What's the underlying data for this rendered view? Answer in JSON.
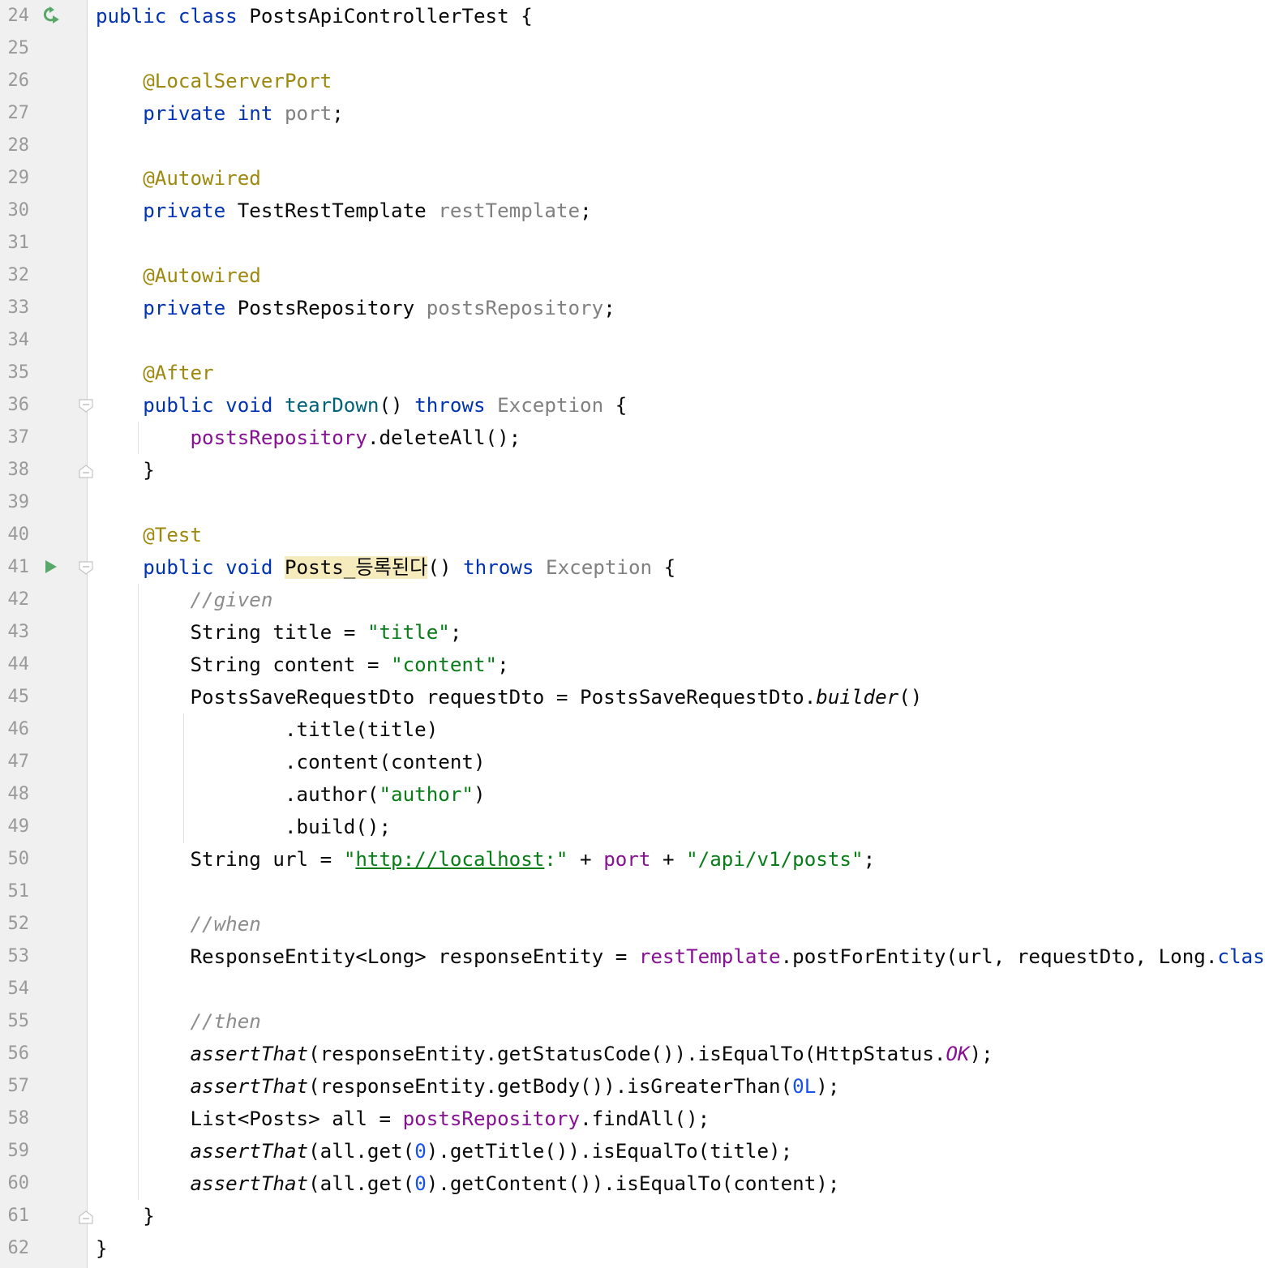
{
  "editor": {
    "file_class": "PostsApiControllerTest",
    "gutter_icons": {
      "24": "run-recycle-icon",
      "41": "run-test-icon"
    },
    "fold_markers": {
      "36": "fold-open",
      "38": "fold-close",
      "41": "fold-open",
      "61": "fold-close"
    },
    "lines": [
      {
        "n": "24",
        "tokens": [
          [
            "kw",
            "public class "
          ],
          [
            "",
            "PostsApiControllerTest {"
          ]
        ]
      },
      {
        "n": "25",
        "tokens": []
      },
      {
        "n": "26",
        "tokens": [
          [
            "",
            "    "
          ],
          [
            "ann",
            "@LocalServerPort"
          ]
        ]
      },
      {
        "n": "27",
        "tokens": [
          [
            "",
            "    "
          ],
          [
            "kw",
            "private int "
          ],
          [
            "unused",
            "port"
          ],
          [
            "",
            ";"
          ]
        ]
      },
      {
        "n": "28",
        "tokens": []
      },
      {
        "n": "29",
        "tokens": [
          [
            "",
            "    "
          ],
          [
            "ann",
            "@Autowired"
          ]
        ]
      },
      {
        "n": "30",
        "tokens": [
          [
            "",
            "    "
          ],
          [
            "kw",
            "private "
          ],
          [
            "",
            "TestRestTemplate "
          ],
          [
            "unused",
            "restTemplate"
          ],
          [
            "",
            ";"
          ]
        ]
      },
      {
        "n": "31",
        "tokens": []
      },
      {
        "n": "32",
        "tokens": [
          [
            "",
            "    "
          ],
          [
            "ann",
            "@Autowired"
          ]
        ]
      },
      {
        "n": "33",
        "tokens": [
          [
            "",
            "    "
          ],
          [
            "kw",
            "private "
          ],
          [
            "",
            "PostsRepository "
          ],
          [
            "unused",
            "postsRepository"
          ],
          [
            "",
            ";"
          ]
        ]
      },
      {
        "n": "34",
        "tokens": []
      },
      {
        "n": "35",
        "tokens": [
          [
            "",
            "    "
          ],
          [
            "ann",
            "@After"
          ]
        ]
      },
      {
        "n": "36",
        "tokens": [
          [
            "",
            "    "
          ],
          [
            "kw",
            "public void "
          ],
          [
            "meth",
            "tearDown"
          ],
          [
            "",
            "() "
          ],
          [
            "kw",
            "throws "
          ],
          [
            "gry",
            "Exception"
          ],
          [
            "",
            " {"
          ]
        ]
      },
      {
        "n": "37",
        "tokens": [
          [
            "",
            "        "
          ],
          [
            "fld",
            "postsRepository"
          ],
          [
            "",
            ".deleteAll();"
          ]
        ]
      },
      {
        "n": "38",
        "tokens": [
          [
            "",
            "    }"
          ]
        ]
      },
      {
        "n": "39",
        "tokens": []
      },
      {
        "n": "40",
        "tokens": [
          [
            "",
            "    "
          ],
          [
            "ann",
            "@Test"
          ]
        ]
      },
      {
        "n": "41",
        "tokens": [
          [
            "",
            "    "
          ],
          [
            "kw",
            "public void "
          ],
          [
            "hl",
            "Posts_등록된다"
          ],
          [
            "",
            "() "
          ],
          [
            "kw",
            "throws "
          ],
          [
            "gry",
            "Exception"
          ],
          [
            "",
            " {"
          ]
        ]
      },
      {
        "n": "42",
        "tokens": [
          [
            "",
            "        "
          ],
          [
            "cmt",
            "//given"
          ]
        ]
      },
      {
        "n": "43",
        "tokens": [
          [
            "",
            "        String title = "
          ],
          [
            "str",
            "\"title\""
          ],
          [
            "",
            ";"
          ]
        ]
      },
      {
        "n": "44",
        "tokens": [
          [
            "",
            "        String content = "
          ],
          [
            "str",
            "\"content\""
          ],
          [
            "",
            ";"
          ]
        ]
      },
      {
        "n": "45",
        "tokens": [
          [
            "",
            "        PostsSaveRequestDto requestDto = PostsSaveRequestDto."
          ],
          [
            "italic",
            "builder"
          ],
          [
            "",
            "()"
          ]
        ]
      },
      {
        "n": "46",
        "tokens": [
          [
            "",
            "                .title(title)"
          ]
        ]
      },
      {
        "n": "47",
        "tokens": [
          [
            "",
            "                .content(content)"
          ]
        ]
      },
      {
        "n": "48",
        "tokens": [
          [
            "",
            "                .author("
          ],
          [
            "str",
            "\"author\""
          ],
          [
            "",
            ")"
          ]
        ]
      },
      {
        "n": "49",
        "tokens": [
          [
            "",
            "                .build();"
          ]
        ]
      },
      {
        "n": "50",
        "tokens": [
          [
            "",
            "        String url = "
          ],
          [
            "str",
            "\""
          ],
          [
            "str link",
            "http://localhost"
          ],
          [
            "str",
            ":\""
          ],
          [
            "",
            " + "
          ],
          [
            "fld",
            "port"
          ],
          [
            "",
            " + "
          ],
          [
            "str",
            "\"/api/v1/posts\""
          ],
          [
            "",
            ";"
          ]
        ]
      },
      {
        "n": "51",
        "tokens": []
      },
      {
        "n": "52",
        "tokens": [
          [
            "",
            "        "
          ],
          [
            "cmt",
            "//when"
          ]
        ]
      },
      {
        "n": "53",
        "tokens": [
          [
            "",
            "        ResponseEntity<Long> responseEntity = "
          ],
          [
            "fld",
            "restTemplate"
          ],
          [
            "",
            ".postForEntity(url, requestDto, Long."
          ],
          [
            "kw",
            "class"
          ],
          [
            "",
            ");"
          ]
        ]
      },
      {
        "n": "54",
        "tokens": []
      },
      {
        "n": "55",
        "tokens": [
          [
            "",
            "        "
          ],
          [
            "cmt",
            "//then"
          ]
        ]
      },
      {
        "n": "56",
        "tokens": [
          [
            "",
            "        "
          ],
          [
            "italic",
            "assertThat"
          ],
          [
            "",
            "(responseEntity.getStatusCode()).isEqualTo(HttpStatus."
          ],
          [
            "fld italic",
            "OK"
          ],
          [
            "",
            ");"
          ]
        ]
      },
      {
        "n": "57",
        "tokens": [
          [
            "",
            "        "
          ],
          [
            "italic",
            "assertThat"
          ],
          [
            "",
            "(responseEntity.getBody()).isGreaterThan("
          ],
          [
            "num",
            "0L"
          ],
          [
            "",
            ");"
          ]
        ]
      },
      {
        "n": "58",
        "tokens": [
          [
            "",
            "        List<Posts> all = "
          ],
          [
            "fld",
            "postsRepository"
          ],
          [
            "",
            ".findAll();"
          ]
        ]
      },
      {
        "n": "59",
        "tokens": [
          [
            "",
            "        "
          ],
          [
            "italic",
            "assertThat"
          ],
          [
            "",
            "(all.get("
          ],
          [
            "num",
            "0"
          ],
          [
            "",
            ").getTitle()).isEqualTo(title);"
          ]
        ]
      },
      {
        "n": "60",
        "tokens": [
          [
            "",
            "        "
          ],
          [
            "italic",
            "assertThat"
          ],
          [
            "",
            "(all.get("
          ],
          [
            "num",
            "0"
          ],
          [
            "",
            ").getContent()).isEqualTo(content);"
          ]
        ]
      },
      {
        "n": "61",
        "tokens": [
          [
            "",
            "    }"
          ]
        ]
      },
      {
        "n": "62",
        "tokens": [
          [
            "",
            "}"
          ]
        ]
      }
    ]
  }
}
